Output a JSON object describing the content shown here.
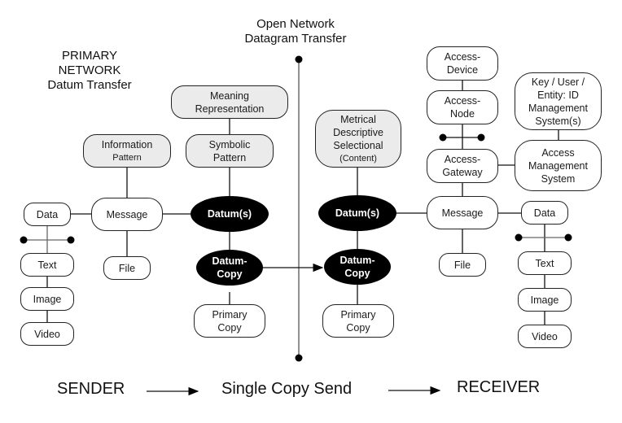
{
  "diagram": {
    "headings": {
      "primary_network": [
        "PRIMARY",
        "NETWORK",
        "Datum Transfer"
      ],
      "open_network": [
        "Open Network",
        "Datagram Transfer"
      ]
    },
    "sender": {
      "meaning_representation": [
        "Meaning",
        "Representation"
      ],
      "information_pattern": [
        "Information",
        "Pattern"
      ],
      "symbolic_pattern": [
        "Symbolic",
        "Pattern"
      ],
      "data": "Data",
      "message": "Message",
      "datums": "Datum(s)",
      "text": "Text",
      "image": "Image",
      "video": "Video",
      "file": "File",
      "datum_copy": [
        "Datum-",
        "Copy"
      ],
      "primary_copy": [
        "Primary",
        "Copy"
      ]
    },
    "receiver": {
      "metrical": [
        "Metrical",
        "Descriptive",
        "Selectional",
        "(Content)"
      ],
      "datums": "Datum(s)",
      "datum_copy": [
        "Datum-",
        "Copy"
      ],
      "primary_copy": [
        "Primary",
        "Copy"
      ],
      "access_device": [
        "Access-",
        "Device"
      ],
      "access_node": [
        "Access-",
        "Node"
      ],
      "access_gateway": [
        "Access-",
        "Gateway"
      ],
      "key_user": [
        "Key / User /",
        "Entity: ID",
        "Management",
        "System(s)"
      ],
      "access_management": [
        "Access",
        "Management",
        "System"
      ],
      "message": "Message",
      "file": "File",
      "data": "Data",
      "text": "Text",
      "image": "Image",
      "video": "Video"
    },
    "flow": {
      "sender": "SENDER",
      "single_copy": "Single Copy Send",
      "receiver": "RECEIVER"
    },
    "colors": {
      "pattern_fill": "#ebebeb",
      "datum_fill": "#000000",
      "stroke": "#222222"
    }
  }
}
